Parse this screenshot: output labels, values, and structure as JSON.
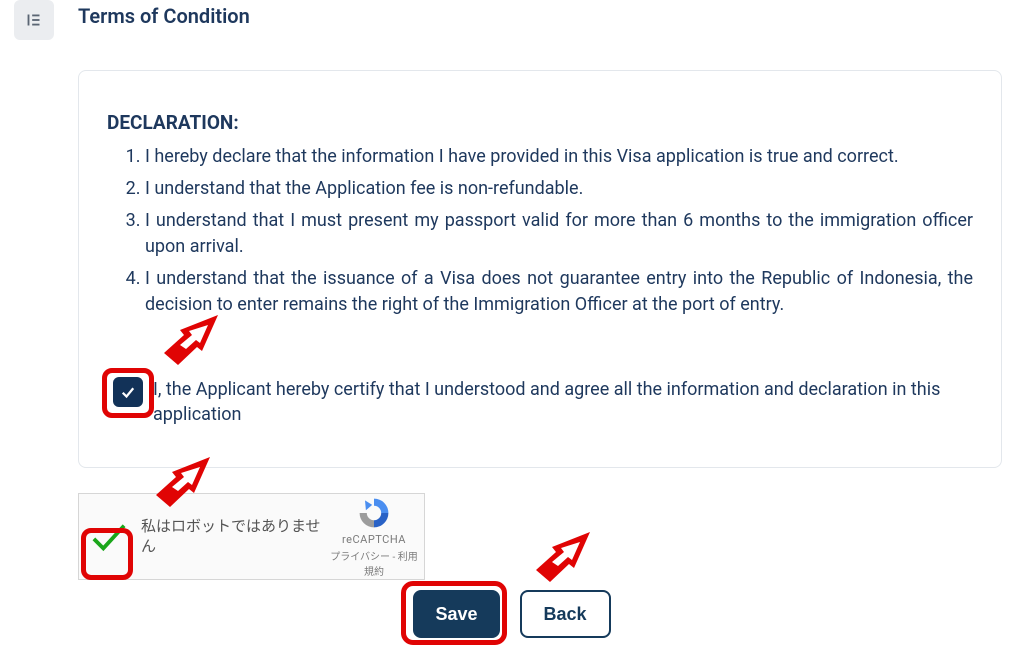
{
  "header": {
    "title": "Terms of Condition"
  },
  "declaration": {
    "heading": "DECLARATION:",
    "items": [
      "I hereby declare that the information I have provided in this Visa application is true and correct.",
      "I understand that the Application fee is non-refundable.",
      "I understand that I must present my passport valid for more than 6 months to the immigration officer upon arrival.",
      "I understand that the issuance of a Visa does not guarantee entry into the Republic of Indonesia, the decision to enter remains the right of the Immigration Officer at the port of entry."
    ]
  },
  "agree": {
    "checked": true,
    "label": "I, the Applicant hereby certify that I understood and agree all the information and declaration in this application"
  },
  "recaptcha": {
    "checked": true,
    "label": "私はロボットではありません",
    "brand": "reCAPTCHA",
    "privacy": "プライバシー",
    "terms": "利用規約",
    "sep": " - "
  },
  "buttons": {
    "save": "Save",
    "back": "Back"
  }
}
